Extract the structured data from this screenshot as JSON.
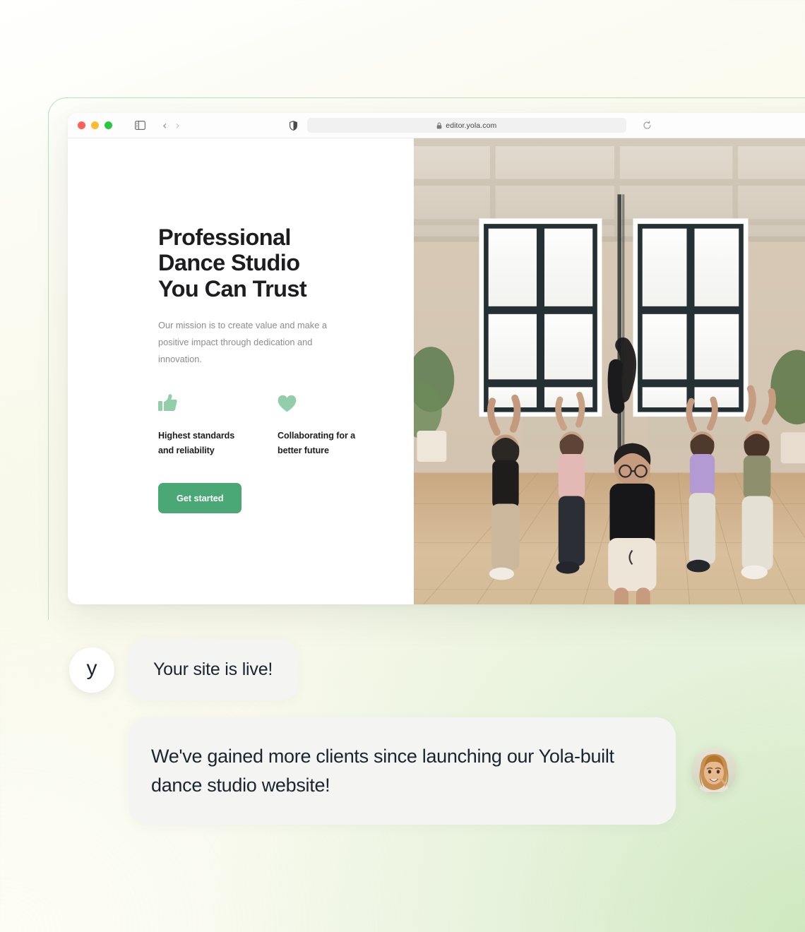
{
  "browser": {
    "url": "editor.yola.com",
    "traffic_lights": [
      "close-red",
      "minimize-yellow",
      "maximize-green"
    ],
    "icons": {
      "sidebar": "sidebar-toggle-icon",
      "back": "‹",
      "forward": "›",
      "shield": "shield-icon",
      "lock": "lock-icon",
      "reload": "reload-icon"
    }
  },
  "hero": {
    "headline_lines": [
      "Professional",
      "Dance Studio",
      "You Can Trust"
    ],
    "paragraph": "Our mission is to create value and make a positive impact through dedication and innovation.",
    "features": [
      {
        "icon": "thumbs-up-icon",
        "label": "Highest standards and reliability"
      },
      {
        "icon": "heart-icon",
        "label": "Collaborating for a better future"
      }
    ],
    "cta_label": "Get started",
    "image_alt": "dance studio class with raised arms"
  },
  "chat": {
    "brand_initial": "y",
    "message_1": "Your site is live!",
    "message_2": "We've gained more clients since launching our Yola-built dance studio website!"
  },
  "colors": {
    "accent_green": "#4aa876",
    "icon_green": "#93ceaa",
    "frame_green": "#b9e0bf",
    "text_dark": "#1d1d1f",
    "text_muted": "#8c8c8c",
    "bubble_bg": "#f4f4f3"
  }
}
